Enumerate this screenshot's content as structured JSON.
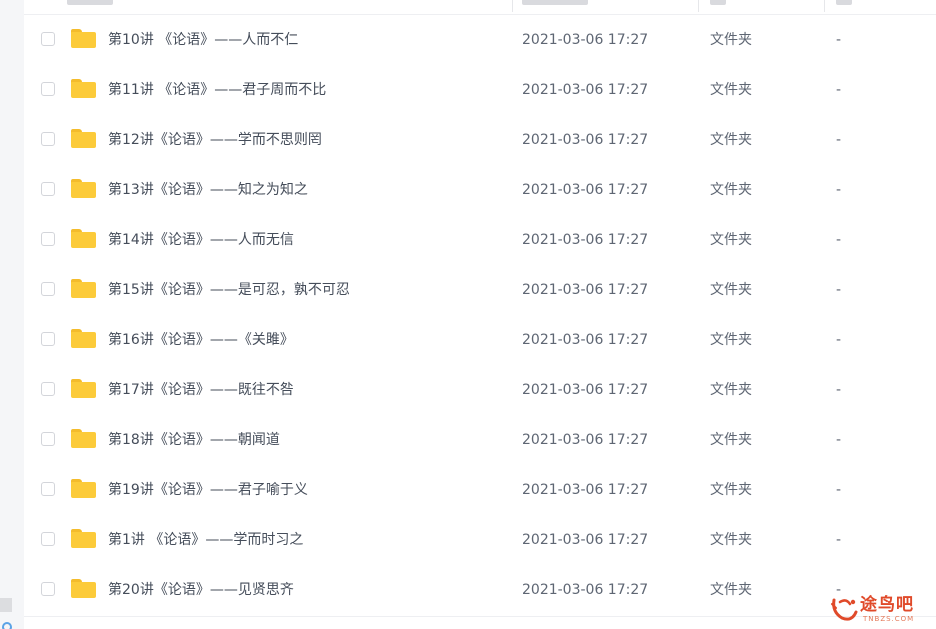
{
  "files": [
    {
      "name": "第10讲 《论语》——人而不仁",
      "modified": "2021-03-06 17:27",
      "type": "文件夹",
      "size": "-"
    },
    {
      "name": "第11讲 《论语》——君子周而不比",
      "modified": "2021-03-06 17:27",
      "type": "文件夹",
      "size": "-"
    },
    {
      "name": "第12讲《论语》——学而不思则罔",
      "modified": "2021-03-06 17:27",
      "type": "文件夹",
      "size": "-"
    },
    {
      "name": "第13讲《论语》——知之为知之",
      "modified": "2021-03-06 17:27",
      "type": "文件夹",
      "size": "-"
    },
    {
      "name": "第14讲《论语》——人而无信",
      "modified": "2021-03-06 17:27",
      "type": "文件夹",
      "size": "-"
    },
    {
      "name": "第15讲《论语》——是可忍，孰不可忍",
      "modified": "2021-03-06 17:27",
      "type": "文件夹",
      "size": "-"
    },
    {
      "name": "第16讲《论语》——《关雎》",
      "modified": "2021-03-06 17:27",
      "type": "文件夹",
      "size": "-"
    },
    {
      "name": "第17讲《论语》——既往不咎",
      "modified": "2021-03-06 17:27",
      "type": "文件夹",
      "size": "-"
    },
    {
      "name": "第18讲《论语》——朝闻道",
      "modified": "2021-03-06 17:27",
      "type": "文件夹",
      "size": "-"
    },
    {
      "name": "第19讲《论语》——君子喻于义",
      "modified": "2021-03-06 17:27",
      "type": "文件夹",
      "size": "-"
    },
    {
      "name": "第1讲 《论语》——学而时习之",
      "modified": "2021-03-06 17:27",
      "type": "文件夹",
      "size": "-"
    },
    {
      "name": "第20讲《论语》——见贤思齐",
      "modified": "2021-03-06 17:27",
      "type": "文件夹",
      "size": "-"
    }
  ],
  "icons": {
    "row_icon": "folder-icon",
    "select_icon": "checkbox-icon"
  },
  "colors": {
    "folder": "#fccb3a",
    "folder_tab": "#f4bc2c",
    "name_text": "#454d5a",
    "meta_text": "#5e6673",
    "watermark": "#e04a2a"
  },
  "watermark": {
    "text": "途鸟吧",
    "sub": "TNBZS.COM"
  }
}
